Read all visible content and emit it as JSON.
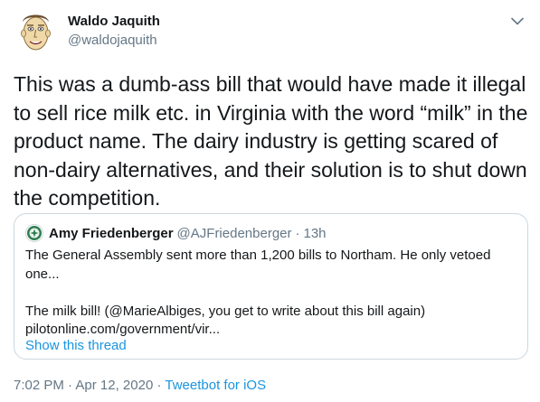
{
  "author": {
    "name": "Waldo Jaquith",
    "handle": "@waldojaquith"
  },
  "tweet": {
    "text": "This was a dumb-ass bill that would have made it illegal to sell rice milk etc. in Virginia with the word “milk” in the product name. The dairy industry is getting scared of non-dairy alternatives, and their solution is to shut down the competition."
  },
  "quoted_tweet": {
    "name": "Amy Friedenberger",
    "handle": "@AJFriedenberger",
    "separator": "·",
    "time": "13h",
    "text": "The General Assembly sent more than 1,200 bills to Northam. He only vetoed one...\n\nThe milk bill! (@MarieAlbiges, you get to write about this bill again)\npilotonline.com/government/vir...",
    "show_thread": "Show this thread"
  },
  "footer": {
    "time": "7:02 PM",
    "separator": "·",
    "date": "Apr 12, 2020",
    "separator2": "·",
    "source": "Tweetbot for iOS"
  },
  "icons": {
    "caret": "chevron-down-icon",
    "avatar": "cartoon-face-avatar",
    "quote_avatar": "green-badge-avatar"
  },
  "colors": {
    "text": "#14171a",
    "secondary": "#657786",
    "link": "#1b95e0",
    "border": "#ccd6dd"
  }
}
